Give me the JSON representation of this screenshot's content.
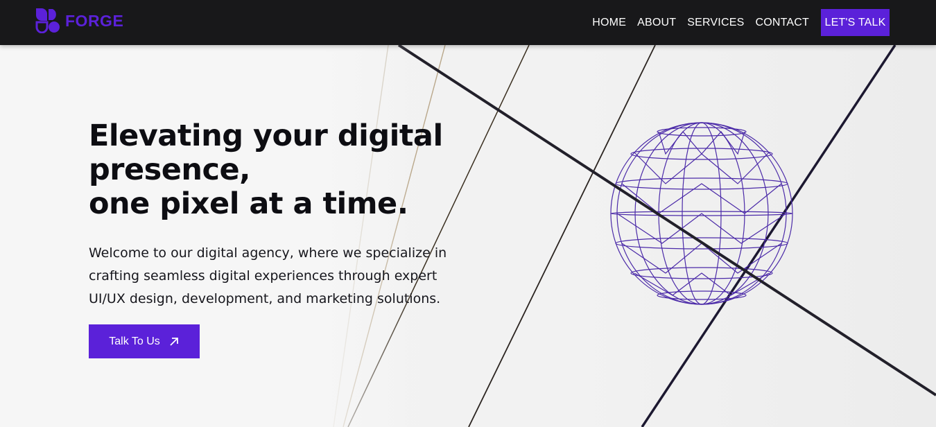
{
  "brand": {
    "name": "FORGE",
    "color": "#5b21d9"
  },
  "nav": {
    "links": [
      "HOME",
      "ABOUT",
      "SERVICES",
      "CONTACT"
    ],
    "cta_label": "LET'S TALK"
  },
  "hero": {
    "title_lines": [
      "Elevating your digital",
      "presence,",
      "one pixel at a time."
    ],
    "description_lines": [
      "Welcome to our digital agency, where we specialize in",
      "crafting seamless digital experiences through expert",
      "UI/UX design, development, and marketing solutions."
    ],
    "cta_label": "Talk To Us",
    "cta_icon": "arrow-up-right-icon",
    "image_subject": "wireframe-sphere-icon"
  },
  "colors": {
    "accent": "#5b21d9",
    "nav_bg": "#18181a",
    "sphere": "#4b2aa8"
  }
}
